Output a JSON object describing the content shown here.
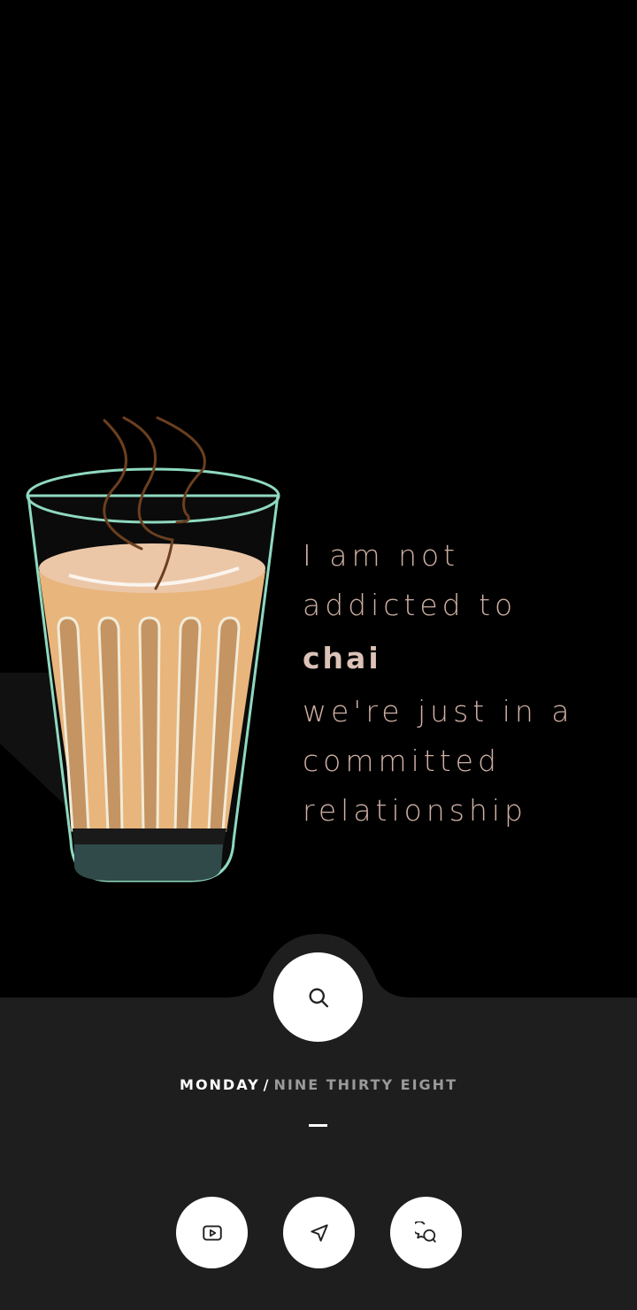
{
  "wallpaper": {
    "quote": {
      "line1": "I am not",
      "line2": "addicted to",
      "emphasis": "chai",
      "line4": "we're just in a",
      "line5": "committed",
      "line6": "relationship"
    }
  },
  "dock": {
    "search_icon": "search-icon",
    "day": "MONDAY",
    "separator": "/",
    "time": "NINE THIRTY EIGHT",
    "apps": [
      {
        "icon": "video-play-icon"
      },
      {
        "icon": "navigation-arrow-icon"
      },
      {
        "icon": "chat-bubbles-icon"
      }
    ]
  },
  "colors": {
    "background": "#000000",
    "dock": "#1e1e1e",
    "quote_text": "#cfb0a4",
    "chai": "#e8b57c",
    "glass_rim": "#8fd9c0"
  }
}
